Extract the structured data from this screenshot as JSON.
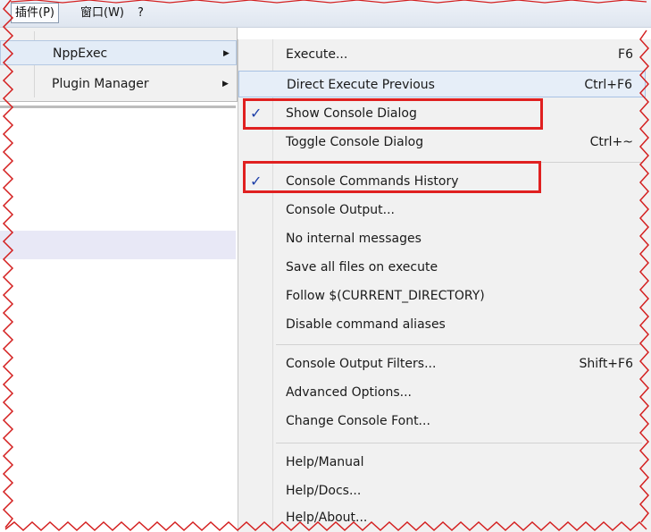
{
  "menubar": {
    "plugins": "插件(P)",
    "window": "窗口(W)",
    "help": "?"
  },
  "plugins_menu": {
    "items": [
      {
        "label": "NppExec"
      },
      {
        "label": "Plugin Manager"
      }
    ]
  },
  "nppexec_menu": {
    "items": [
      {
        "label": "Execute...",
        "shortcut": "F6"
      },
      {
        "label": "Direct Execute Previous",
        "shortcut": "Ctrl+F6"
      },
      {
        "label": "Show Console Dialog",
        "shortcut": "",
        "check": "✓"
      },
      {
        "label": "Toggle Console Dialog",
        "shortcut": "Ctrl+~"
      },
      {
        "label": "Console Commands History",
        "shortcut": "",
        "check": "✓"
      },
      {
        "label": "Console Output...",
        "shortcut": ""
      },
      {
        "label": "No internal messages",
        "shortcut": ""
      },
      {
        "label": "Save all files on execute",
        "shortcut": ""
      },
      {
        "label": "Follow $(CURRENT_DIRECTORY)",
        "shortcut": ""
      },
      {
        "label": "Disable command aliases",
        "shortcut": ""
      },
      {
        "label": "Console Output Filters...",
        "shortcut": "Shift+F6"
      },
      {
        "label": "Advanced Options...",
        "shortcut": ""
      },
      {
        "label": "Change Console Font...",
        "shortcut": ""
      },
      {
        "label": "Help/Manual",
        "shortcut": ""
      },
      {
        "label": "Help/Docs...",
        "shortcut": ""
      },
      {
        "label": "Help/About...",
        "shortcut": ""
      }
    ]
  },
  "colors": {
    "callout": "#e02020",
    "check": "#1d3fa8",
    "menu_bg": "#f1f1f1"
  }
}
